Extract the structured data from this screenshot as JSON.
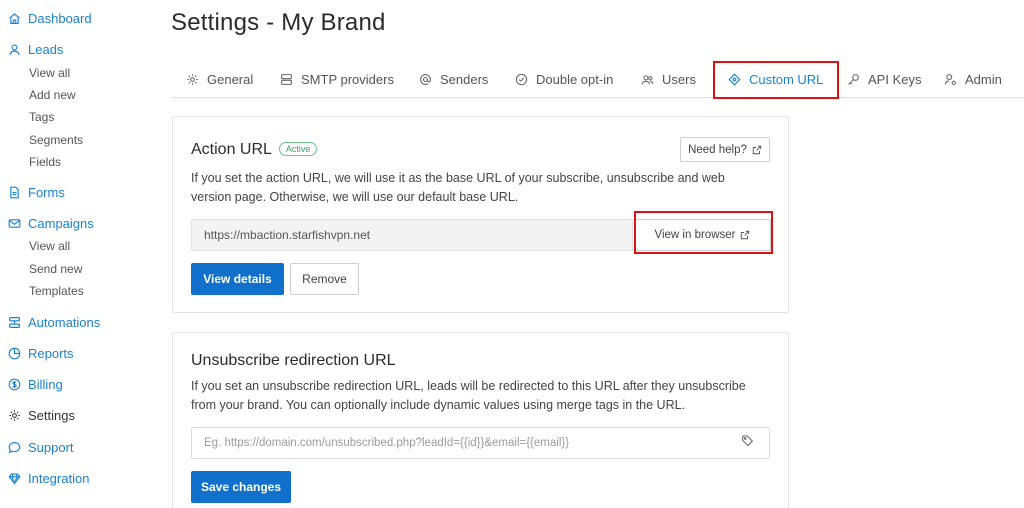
{
  "sidebar": {
    "items": [
      {
        "label": "Dashboard",
        "icon": "home-icon"
      },
      {
        "label": "Leads",
        "icon": "user-icon",
        "children": [
          "View all",
          "Add new",
          "Tags",
          "Segments",
          "Fields"
        ]
      },
      {
        "label": "Forms",
        "icon": "document-icon"
      },
      {
        "label": "Campaigns",
        "icon": "envelope-icon",
        "children": [
          "View all",
          "Send new",
          "Templates"
        ]
      },
      {
        "label": "Automations",
        "icon": "automation-icon"
      },
      {
        "label": "Reports",
        "icon": "report-icon"
      },
      {
        "label": "Billing",
        "icon": "dollar-icon"
      },
      {
        "label": "Settings",
        "icon": "gear-icon"
      },
      {
        "label": "Support",
        "icon": "chat-icon"
      },
      {
        "label": "Integration",
        "icon": "diamond-icon"
      }
    ]
  },
  "page": {
    "title": "Settings - My Brand"
  },
  "tabs": [
    {
      "label": "General",
      "icon": "gear-icon"
    },
    {
      "label": "SMTP providers",
      "icon": "server-icon"
    },
    {
      "label": "Senders",
      "icon": "at-icon"
    },
    {
      "label": "Double opt-in",
      "icon": "check-circle-icon"
    },
    {
      "label": "Users",
      "icon": "users-icon"
    },
    {
      "label": "Custom URL",
      "icon": "diamond-tag-icon",
      "active": true
    },
    {
      "label": "API Keys",
      "icon": "key-icon"
    },
    {
      "label": "Admin",
      "icon": "user-gear-icon"
    }
  ],
  "action_card": {
    "title": "Action URL",
    "badge": "Active",
    "help_label": "Need help?",
    "description_line1": "If you set the action URL, we will use it as the base URL of your subscribe, unsubscribe and web",
    "description_line2": "version page. Otherwise, we will use our default base URL.",
    "url_value": "https://mbaction.starfishvpn.net",
    "view_browser_label": "View in browser",
    "view_details_label": "View details",
    "remove_label": "Remove"
  },
  "unsub_card": {
    "title": "Unsubscribe redirection URL",
    "description_line1": "If you set an unsubscribe redirection URL, leads will be redirected to this URL after they unsubscribe",
    "description_line2": "from your brand. You can optionally include dynamic values using merge tags in the URL.",
    "input_placeholder": "Eg. https://domain.com/unsubscribed.php?leadId={{id}}&email={{email}}",
    "save_label": "Save changes"
  },
  "colors": {
    "accent": "#1a82d6",
    "primary_button": "#1070cc",
    "highlight": "#e01010",
    "badge_green": "#3ba55c"
  }
}
